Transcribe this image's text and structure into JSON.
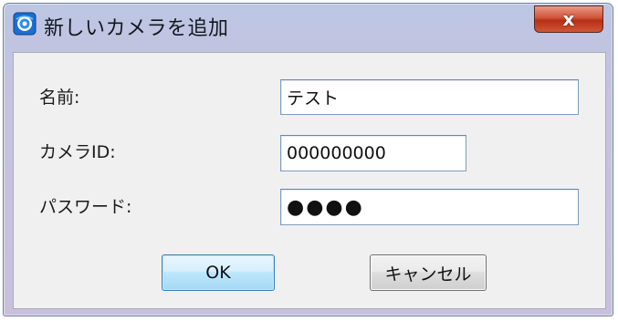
{
  "window": {
    "title": "新しいカメラを追加",
    "close_label": "x"
  },
  "form": {
    "name_label": "名前:",
    "name_value": "テスト",
    "camera_id_label": "カメラID:",
    "camera_id_value": "000000000",
    "password_label": "パスワード:",
    "password_value": "●●●●"
  },
  "buttons": {
    "ok_label": "OK",
    "cancel_label": "キャンセル"
  },
  "icons": {
    "app": "app-camera-icon",
    "close": "close-icon"
  }
}
